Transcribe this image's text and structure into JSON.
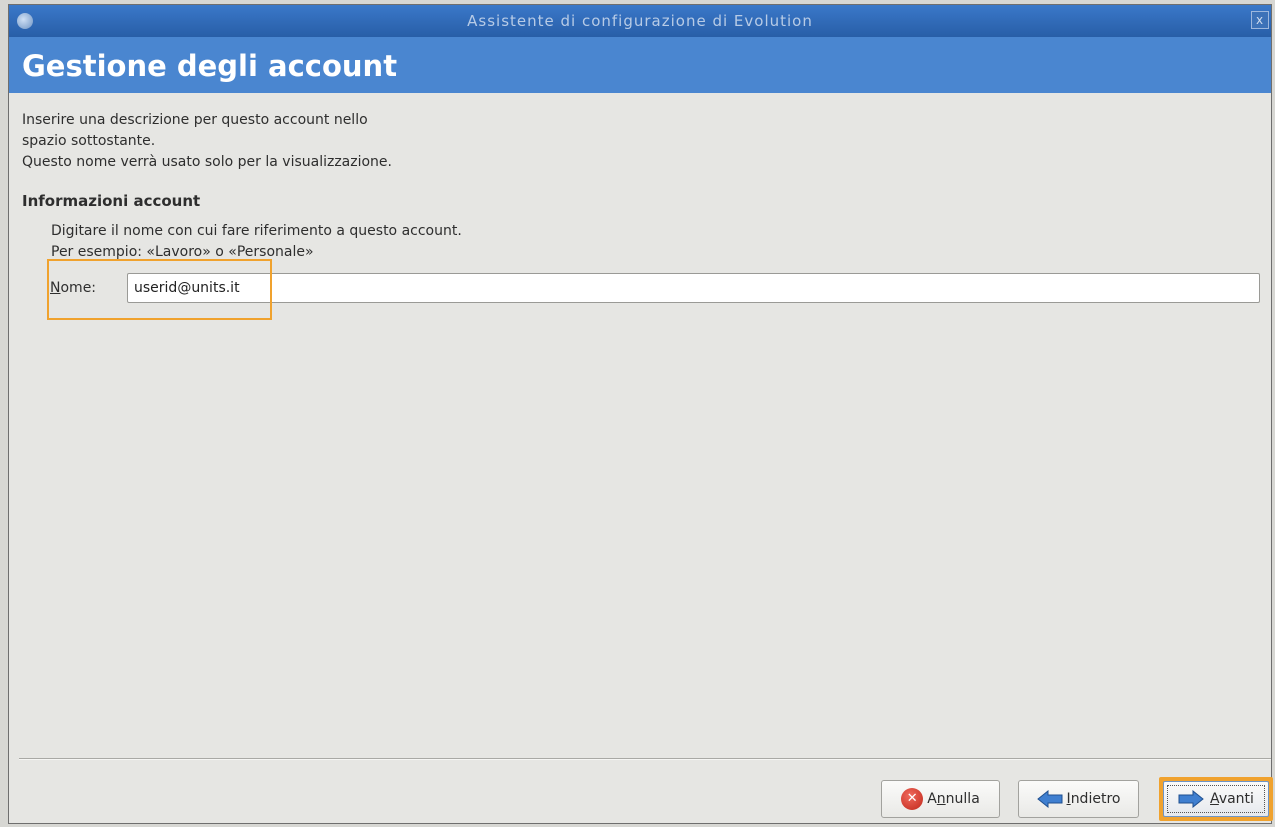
{
  "window": {
    "title": "Assistente di configurazione di Evolution",
    "close_glyph": "x",
    "app_icon": "evolution-icon"
  },
  "header": {
    "title": "Gestione degli account",
    "background_color": "#4a86d0"
  },
  "intro": {
    "line1": "Inserire una descrizione per questo account nello",
    "line2": "spazio sottostante.",
    "line3": "Questo nome verrà usato solo per la visualizzazione."
  },
  "account_info": {
    "section_title": "Informazioni account",
    "hint_line1": "Digitare il nome con cui fare riferimento a questo account.",
    "hint_line2": "Per esempio: «Lavoro» o «Personale»",
    "name_label_mnemonic": "N",
    "name_label_rest": "ome:",
    "name_value": "userid@units.it"
  },
  "buttons": {
    "cancel": {
      "label_pre": "A",
      "mnemonic": "n",
      "label_post": "nulla",
      "icon": "cancel-icon",
      "icon_glyph": "✕"
    },
    "back": {
      "label_pre": "",
      "mnemonic": "I",
      "label_post": "ndietro",
      "icon": "arrow-left-icon"
    },
    "next": {
      "label_pre": "",
      "mnemonic": "A",
      "label_post": "vanti",
      "icon": "arrow-right-icon"
    }
  },
  "highlight_color": "#f0a22e"
}
